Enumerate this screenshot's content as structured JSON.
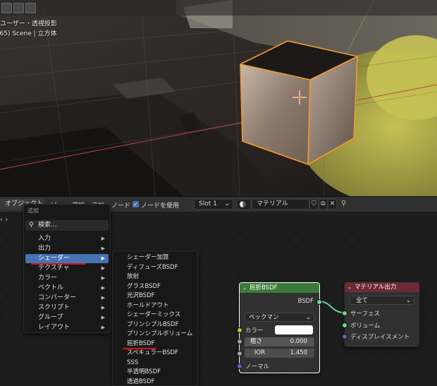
{
  "viewport": {
    "info_line1": "ユーザー・透視投影",
    "info_line2": "(65) Scene | 立方体"
  },
  "header": {
    "object_menu": "オブジェクト",
    "view": "ビ",
    "select": "選択",
    "add": "追加",
    "node": "ノード",
    "use_nodes_label": "ノードを使用",
    "slot": "Slot 1",
    "material_name": "マテリアル"
  },
  "add_menu": {
    "title": "追加",
    "search": "検索...",
    "items": [
      "入力",
      "出力",
      "シェーダー",
      "テクスチャ",
      "カラー",
      "ベクトル",
      "コンバーター",
      "スクリプト",
      "グループ",
      "レイアウト"
    ]
  },
  "shader_submenu": {
    "items": [
      "シェーダー加算",
      "ディフューズBSDF",
      "放射",
      "グラスBSDF",
      "光沢BSDF",
      "ホールドアウト",
      "シェーダーミックス",
      "プリンシプルBSDF",
      "プリンシプルボリューム",
      "屈折BSDF",
      "スペキュラーBSDF",
      "SSS",
      "半透明BSDF",
      "透過BSDF"
    ]
  },
  "refraction_node": {
    "title": "屈折BSDF",
    "output": "BSDF",
    "distribution": "ベックマン",
    "color_label": "カラー",
    "roughness_label": "粗さ",
    "roughness_value": "0.000",
    "ior_label": "IOR",
    "ior_value": "1.450",
    "normal_label": "ノーマル"
  },
  "output_node": {
    "title": "マテリアル出力",
    "target": "全て",
    "surface": "サーフェス",
    "volume": "ボリューム",
    "displacement": "ディスプレイスメント"
  }
}
